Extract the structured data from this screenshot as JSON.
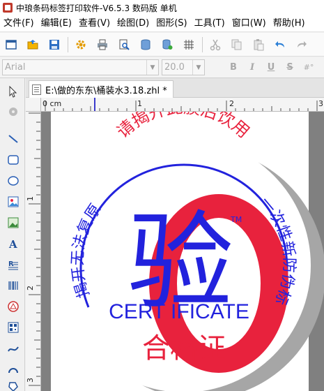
{
  "window": {
    "title": "中琅条码标签打印软件-V6.5.3 数码版 单机"
  },
  "menu": [
    {
      "label": "文件(F)"
    },
    {
      "label": "编辑(E)"
    },
    {
      "label": "查看(V)"
    },
    {
      "label": "绘图(D)"
    },
    {
      "label": "图形(S)"
    },
    {
      "label": "工具(T)"
    },
    {
      "label": "窗口(W)"
    },
    {
      "label": "帮助(H)"
    }
  ],
  "toolbar": {
    "icons": [
      "new-icon",
      "open-icon",
      "save-icon",
      "settings-icon",
      "print-icon",
      "print-preview-icon",
      "database-icon",
      "database-settings-icon",
      "grid-icon",
      "cut-icon",
      "copy-icon",
      "paste-icon",
      "undo-icon",
      "redo-icon"
    ]
  },
  "fontbar": {
    "font_name": "Arial",
    "font_size": "20.0",
    "bold": "B",
    "italic": "I",
    "underline": "U",
    "strike": "S",
    "more": "#°"
  },
  "tools": {
    "icons": [
      "select-icon",
      "pan-icon",
      "line-icon",
      "rounded-rect-icon",
      "ellipse-icon",
      "image-icon",
      "picture-icon",
      "text-icon",
      "rich-text-icon",
      "barcode-icon",
      "qrcode-icon",
      "datamatrix-icon",
      "curve-icon",
      "arc-icon",
      "polygon-icon"
    ]
  },
  "document": {
    "tab_title": "E:\\做的东东\\桶装水3.18.zhl *"
  },
  "rulers": {
    "h_unit": "0 cm",
    "h_labels": [
      "1",
      "2",
      "3"
    ],
    "v_labels": [
      "1",
      "2",
      "3"
    ]
  },
  "label": {
    "top_arc_text": "请揭开此膜后饮用",
    "left_arc_text": "揭开无法复原",
    "right_arc_text": "一次性新防伪标",
    "big_letter": "O",
    "center_char": "验",
    "tm": "TM",
    "certificate": "CERT IFICATE",
    "bottom_text": "合格证",
    "colors": {
      "red": "#e8223d",
      "blue": "#2222dd",
      "white": "#ffffff"
    }
  }
}
